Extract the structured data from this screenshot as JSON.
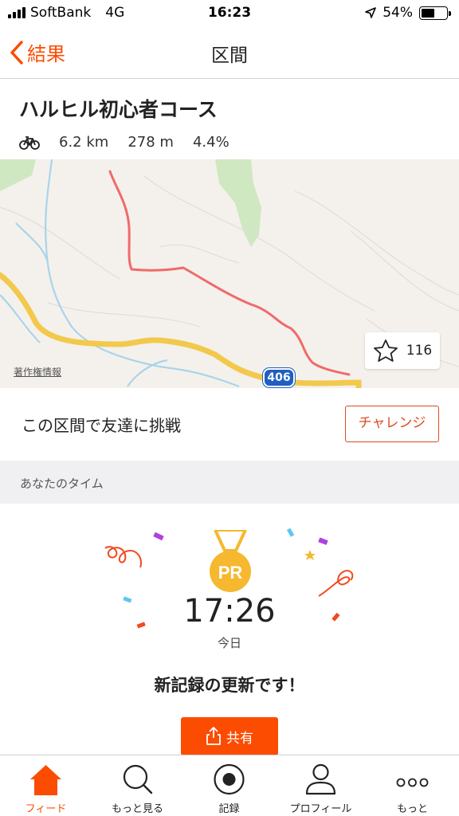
{
  "status_bar": {
    "carrier": "SoftBank",
    "network": "4G",
    "time": "16:23",
    "battery": "54%",
    "battery_level": 0.54
  },
  "nav": {
    "back_label": "結果",
    "title": "区間"
  },
  "segment": {
    "name": "ハルヒル初心者コース",
    "distance": "6.2 km",
    "elevation": "278 m",
    "grade": "4.4%",
    "activity_icon": "bicycle-icon"
  },
  "map": {
    "attribution": "著作権情報",
    "road_number": "406",
    "star_count": "116"
  },
  "challenge": {
    "text": "この区間で友達に挑戦",
    "button_label": "チャレンジ"
  },
  "your_time": {
    "section_label": "あなたのタイム",
    "medal_label": "PR",
    "time": "17:26",
    "date": "今日",
    "message": "新記録の更新です！",
    "share_label": "共有"
  },
  "tabs": [
    {
      "label": "フィード",
      "icon": "home-icon",
      "active": true
    },
    {
      "label": "もっと見る",
      "icon": "search-icon",
      "active": false
    },
    {
      "label": "記録",
      "icon": "record-icon",
      "active": false
    },
    {
      "label": "プロフィール",
      "icon": "profile-icon",
      "active": false
    },
    {
      "label": "もっと",
      "icon": "more-icon",
      "active": false
    }
  ],
  "colors": {
    "accent": "#fc4c02",
    "challenge_border": "#e04a1f",
    "route": "#f06a6a",
    "road": "#f2c94c",
    "medal": "#f5b82e"
  }
}
